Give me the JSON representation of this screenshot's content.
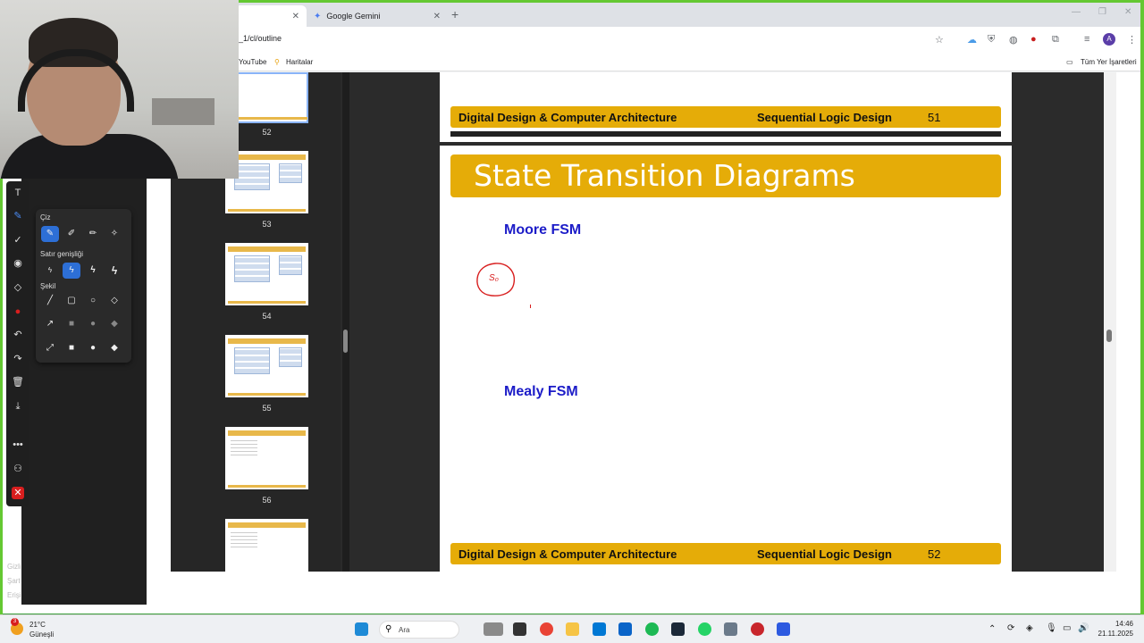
{
  "browser": {
    "tabs": [
      {
        "label": ""
      },
      {
        "label": "Google Gemini"
      }
    ],
    "url": "_1/cl/outline",
    "bookmarks": {
      "youtube": "YouTube",
      "maps": "Haritalar",
      "all": "Tüm Yer İşaretleri"
    },
    "profile_initial": "A"
  },
  "thumbnails": [
    {
      "page": "52"
    },
    {
      "page": "53"
    },
    {
      "page": "54"
    },
    {
      "page": "55"
    },
    {
      "page": "56"
    }
  ],
  "slides": {
    "footer_left": "Digital Design & Computer Architecture",
    "footer_right": "Sequential Logic Design",
    "prev_page_number": "51",
    "next_page_number": "52",
    "title": "State Transition Diagrams",
    "moore_heading": "Moore FSM",
    "mealy_heading": "Mealy FSM",
    "annotation_state": "S₀"
  },
  "draw_popup": {
    "draw_label": "Çiz",
    "line_width_label": "Satır genişliği",
    "shape_label": "Şekil"
  },
  "side_labels": [
    "Gizli",
    "Şart",
    "Erişi"
  ],
  "taskbar": {
    "weather_temp": "21°C",
    "weather_desc": "Güneşli",
    "weather_badge": "3",
    "search_placeholder": "Ara",
    "time": "14:46",
    "date": "21.11.2025"
  },
  "colors": {
    "slide_yellow": "#e5ac08",
    "heading_blue": "#1c1cc8",
    "frame_green": "#64c832",
    "active_tool_blue": "#4c8df6",
    "annotation_red": "#d81e1e"
  }
}
